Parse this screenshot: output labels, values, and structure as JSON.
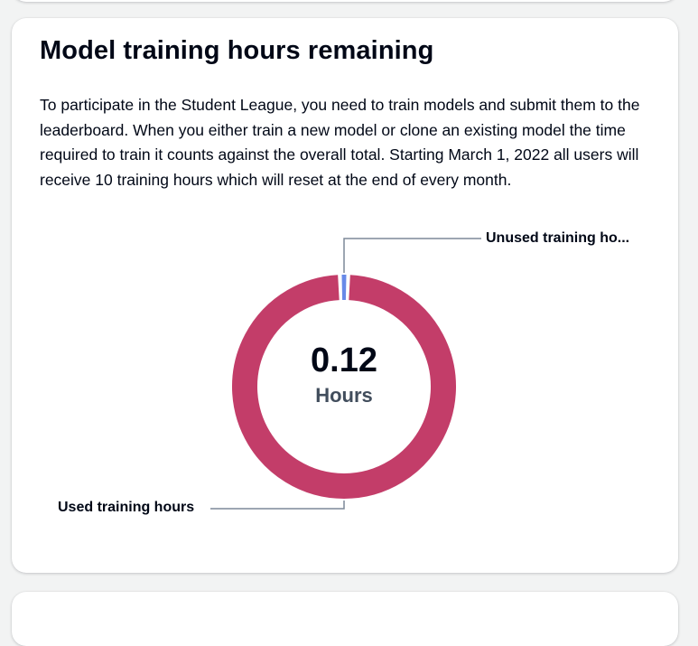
{
  "card": {
    "title": "Model training hours remaining",
    "description": "To participate in the Student League, you need to train models and submit them to the leaderboard. When you either train a new model or clone an existing model the time required to train it counts against the overall total. Starting March 1, 2022 all users will receive 10 training hours which will reset at the end of every month."
  },
  "chart_data": {
    "type": "pie",
    "variant": "donut",
    "center_value": "0.12",
    "center_unit": "Hours",
    "segments": [
      {
        "name": "Unused training ho...",
        "value": 0.12,
        "color": "#688ae8"
      },
      {
        "name": "Used training hours",
        "value": 9.88,
        "color": "#c33d69"
      }
    ]
  }
}
